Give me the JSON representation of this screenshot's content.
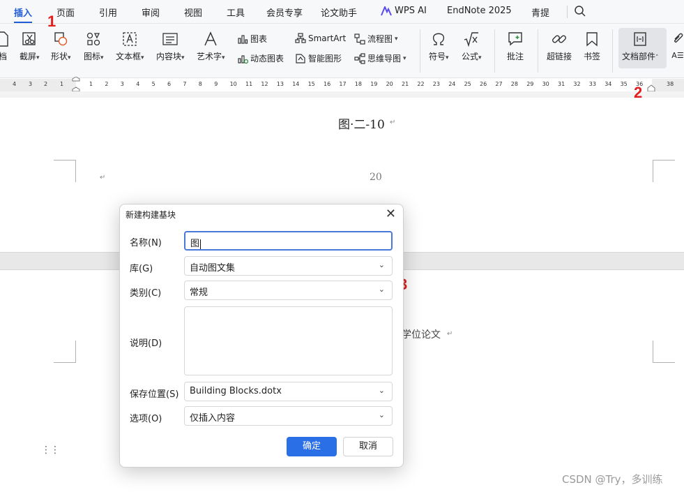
{
  "menubar": {
    "tabs": [
      "插入",
      "页面",
      "引用",
      "审阅",
      "视图",
      "工具",
      "会员专享",
      "论文助手",
      "WPS AI",
      "EndNote 2025",
      "青提"
    ],
    "active": "插入",
    "accent": "#1f5cd6"
  },
  "ribbon": {
    "big_buttons": {
      "doc_partial": "档",
      "screenshot": "截屏",
      "shape": "形状",
      "icon": "图标",
      "textbox": "文本框",
      "content_block": "内容块",
      "wordart": "艺术字",
      "symbol": "符号",
      "formula": "公式",
      "comment": "批注",
      "hyperlink": "超链接",
      "bookmark": "书签",
      "doc_parts": "文档部件"
    },
    "small_buttons": {
      "chart": "图表",
      "smartart": "SmartArt",
      "flowchart": "流程图",
      "dynamic_chart": "动态图表",
      "smart_shape": "智能图形",
      "mindmap": "思维导图"
    }
  },
  "ruler": {
    "left_numbers": [
      "4",
      "3",
      "2",
      "1"
    ],
    "numbers": [
      "1",
      "2",
      "3",
      "4",
      "5",
      "6",
      "7",
      "8",
      "9",
      "10",
      "11",
      "12",
      "13",
      "14",
      "15",
      "16",
      "17",
      "18",
      "19",
      "20",
      "21",
      "22",
      "23",
      "24",
      "25",
      "26",
      "27",
      "28",
      "29",
      "30",
      "31",
      "32",
      "33",
      "34",
      "35",
      "36"
    ],
    "right_number": "38"
  },
  "document": {
    "caption": "图·二-10",
    "page_number": "20",
    "body_fragment": "学位论文"
  },
  "annotations": [
    "1",
    "2",
    "3"
  ],
  "dialog": {
    "title": "新建构建基块",
    "fields": {
      "name_label": "名称(N)",
      "name_value": "图",
      "gallery_label": "库(G)",
      "gallery_value": "自动图文集",
      "category_label": "类别(C)",
      "category_value": "常规",
      "description_label": "说明(D)",
      "save_label": "保存位置(S)",
      "save_value": "Building Blocks.dotx",
      "options_label": "选项(O)",
      "options_value": "仅插入内容"
    },
    "ok": "确定",
    "cancel": "取消",
    "ok_color": "#2a6fe6"
  },
  "watermark": "CSDN @Try，多训练"
}
